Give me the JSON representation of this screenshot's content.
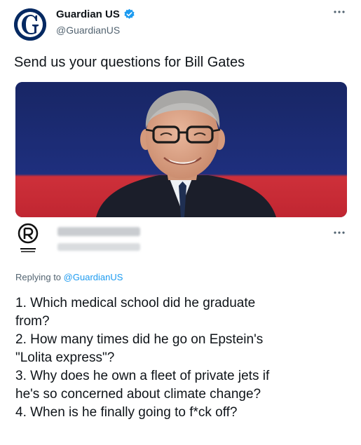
{
  "tweet": {
    "author_name": "Guardian US",
    "author_handle": "@GuardianUS",
    "text": "Send us your questions for Bill Gates",
    "image": "photo-of-man-smiling"
  },
  "reply": {
    "replying_label": "Replying to",
    "replying_mention": "@GuardianUS",
    "lines": [
      "1. Which medical school did he graduate",
      "from?",
      "2. How many times did he go on Epstein's",
      "\"Lolita express\"?",
      "3. Why does he own a fleet of private jets if",
      "he's so concerned about climate change?",
      "4. When is he finally going to f*ck off?"
    ]
  },
  "colors": {
    "guardian_blue": "#052962",
    "verified_blue": "#1d9bf0",
    "muted_text": "#536471",
    "photo_backdrop_blue": "#1c2c73",
    "photo_backdrop_red": "#e0343f"
  },
  "icons": [
    "guardian-logo-icon",
    "verified-badge-icon",
    "more-options-icon"
  ]
}
